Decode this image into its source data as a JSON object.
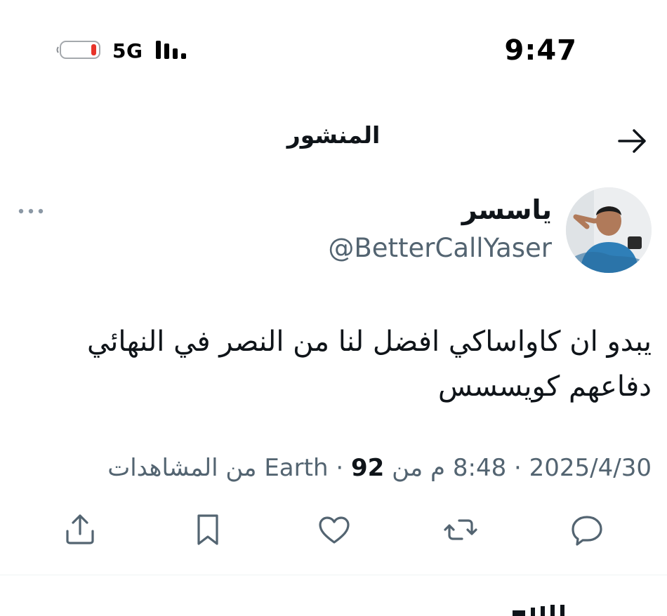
{
  "status_bar": {
    "time": "9:47",
    "network": "5G",
    "battery_level": 0.15,
    "battery_color": "#e8342a"
  },
  "header": {
    "title": "المنشور",
    "back_icon": "arrow-right-icon"
  },
  "post": {
    "author": {
      "display_name": "ياسسر",
      "handle": "@BetterCallYaser"
    },
    "text_line1": "يبدو ان كاواساكي افضل لنا من النصر في النهائي",
    "text_line2": "دفاعهم كويسسس",
    "meta": {
      "date": "2025/4/30",
      "time": "8:48 م",
      "location_prefix": "من",
      "location": "Earth",
      "views_count": "92",
      "views_label": "من المشاهدات",
      "separator": "·"
    },
    "actions": [
      "reply-icon",
      "retweet-icon",
      "like-icon",
      "bookmark-icon",
      "share-icon"
    ]
  },
  "colors": {
    "text_primary": "#0f1419",
    "text_secondary": "#536471",
    "divider": "#eff3f4"
  }
}
